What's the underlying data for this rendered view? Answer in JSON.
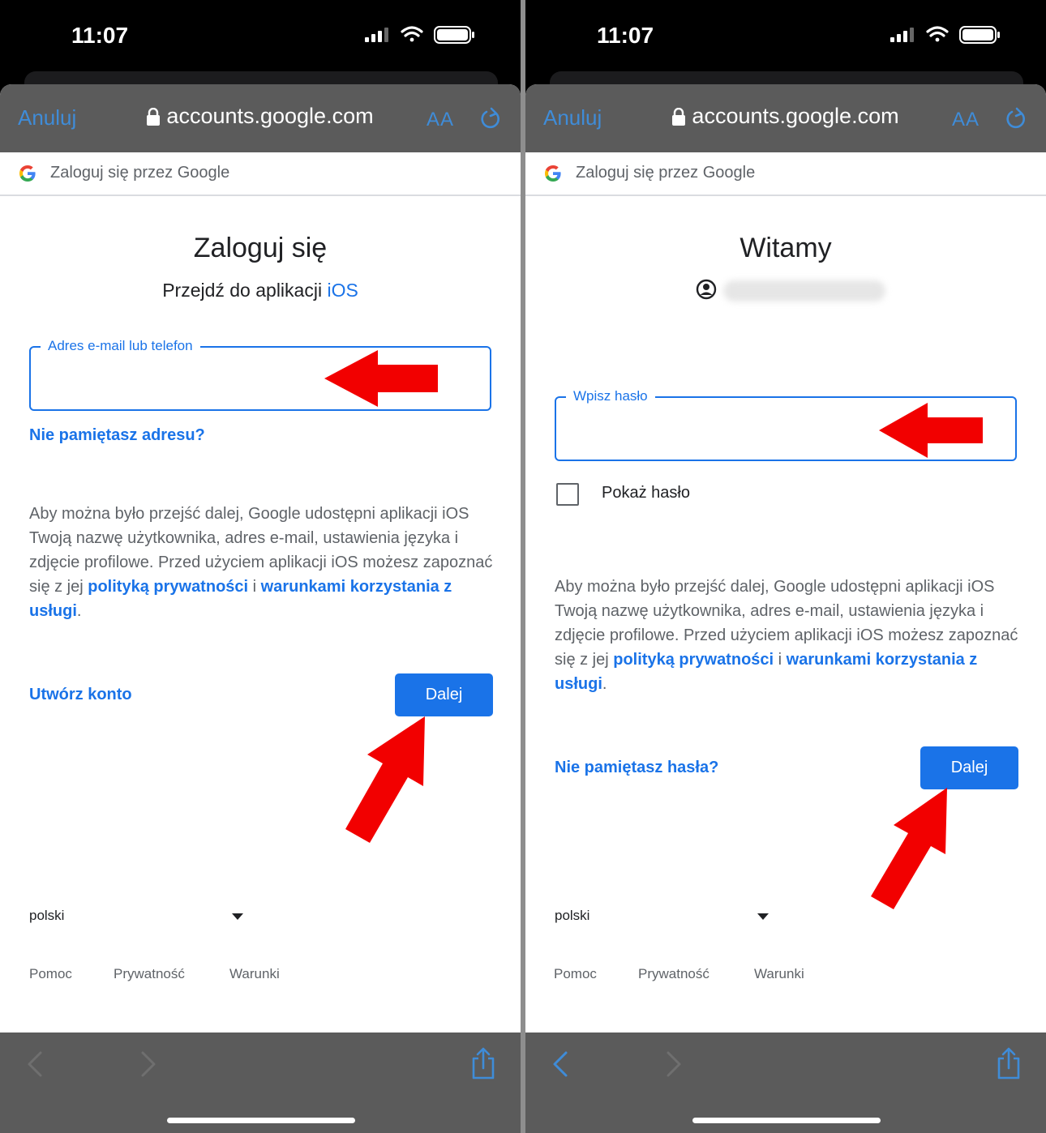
{
  "status": {
    "time": "11:07"
  },
  "browser": {
    "cancel_label": "Anuluj",
    "url": "accounts.google.com",
    "text_size_label": "AA"
  },
  "google_header": {
    "text": "Zaloguj się przez Google"
  },
  "screens": [
    {
      "title": "Zaloguj się",
      "subtitle_prefix": "Przejdź do aplikacji ",
      "subtitle_app": "iOS",
      "field_label": "Adres e-mail lub telefon",
      "field_value": "",
      "forgot_link": "Nie pamiętasz adresu?",
      "create_account_link": "Utwórz konto",
      "next_button": "Dalej"
    },
    {
      "title": "Witamy",
      "field_label": "Wpisz hasło",
      "field_value": "",
      "show_password_label": "Pokaż hasło",
      "show_password_checked": false,
      "forgot_link": "Nie pamiętasz hasła?",
      "next_button": "Dalej"
    }
  ],
  "consent": {
    "text_before": "Aby można było przejść dalej, Google udostępni aplikacji iOS Twoją nazwę użytkownika, adres e-mail, ustawienia języka i zdjęcie profilowe. Przed użyciem aplikacji iOS możesz zapoznać się z jej ",
    "privacy_link": "polityką prywatności",
    "and": " i ",
    "terms_link": "warunkami korzystania z usługi",
    "end": "."
  },
  "footer": {
    "language": "polski",
    "help": "Pomoc",
    "privacy": "Prywatność",
    "terms": "Warunki"
  },
  "colors": {
    "google_blue": "#1a73e8",
    "safari_blue": "#3f8cd8",
    "annotation_red": "#f20000",
    "toolbar_gray": "#5b5b5b"
  }
}
